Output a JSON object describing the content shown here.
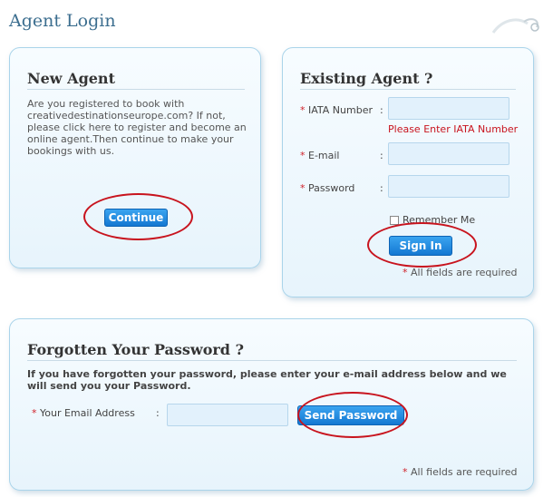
{
  "page": {
    "title": "Agent Login"
  },
  "new_agent": {
    "title": "New Agent",
    "description": "Are you registered to book with creativedestinationseurope.com? If not, please click here to register and become an online agent.Then continue to make your bookings with us.",
    "continue_label": "Continue"
  },
  "existing_agent": {
    "title": "Existing Agent ?",
    "iata_label": "IATA Number",
    "iata_value": "",
    "iata_error": "Please Enter IATA Number",
    "email_label": "E-mail",
    "email_value": "",
    "password_label": "Password",
    "password_value": "",
    "remember_label": "Remember Me",
    "remember_checked": false,
    "signin_label": "Sign In",
    "required_note": "All fields are required",
    "required_mark": "*",
    "colon": ":"
  },
  "forgot": {
    "title": "Forgotten Your Password ?",
    "instructions": "If you have forgotten your password, please enter your e-mail address below and we will send you your Password.",
    "email_label": "Your Email Address",
    "email_value": "",
    "send_label": "Send Password",
    "required_note": "All fields are required",
    "required_mark": "*",
    "colon": ":"
  },
  "colors": {
    "accent": "#1478d2",
    "error": "#c8141e",
    "panel_border": "#aad4ea",
    "title": "#3c6e8f"
  }
}
